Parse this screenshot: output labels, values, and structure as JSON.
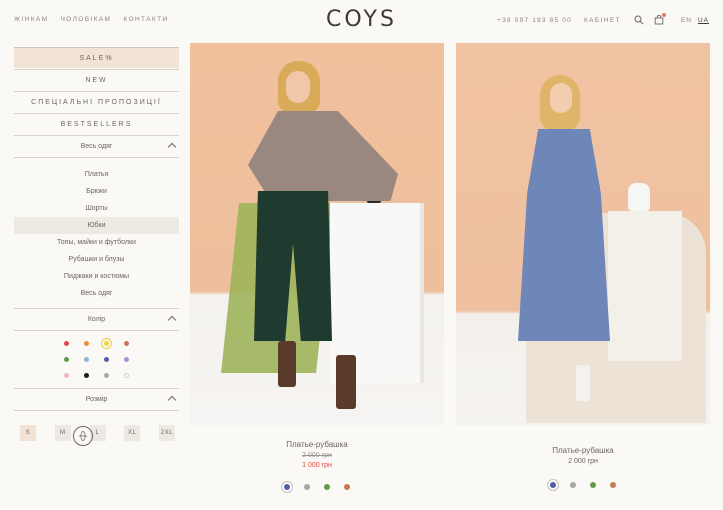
{
  "header": {
    "nav_women": "ЖІНКАМ",
    "nav_men": "ЧОЛОВІКАМ",
    "nav_contacts": "КОНТАКТИ",
    "logo": "COYS",
    "phone": "+38 097 193 85 00",
    "cabinet": "КАБІНЕТ",
    "icons": [
      "search-icon",
      "cart-icon"
    ],
    "lang_en": "EN",
    "lang_ua": "UA"
  },
  "sidebar": {
    "sale": "SALE%",
    "new": "NEW",
    "special": "СПЕЦІАЛЬНІ ПРОПОЗИЦІЇ",
    "bestsellers": "BESTSELLERS",
    "all_clothes_head": "Весь одяг",
    "categories": [
      "Платья",
      "Брюки",
      "Шорты",
      "Юбки",
      "Топы, майки и футболки",
      "Рубашки и блузы",
      "Пиджаки и костюмы",
      "Весь одяг"
    ],
    "active_category": "Юбки",
    "color_head": "Колір",
    "swatches": [
      "#e5484d",
      "#ef8f3a",
      "#f3d23a",
      "#c27a56",
      "#5f9a4a",
      "#8fb6d8",
      "#5060a8",
      "#a98fd4",
      "#f2b6c2",
      "#1b1b1b",
      "#a9a9a9",
      "#ffffff"
    ],
    "selected_swatch": "#f3d23a",
    "size_head": "Розмір",
    "sizes": [
      "S",
      "M",
      "L",
      "XL",
      "2XL"
    ],
    "selected_size": "S"
  },
  "products": [
    {
      "name": "Платье-рубашка",
      "old_price": "2 000 грн",
      "price": "1 000 грн",
      "colors": [
        "#4f5fb0",
        "#a7a7a7",
        "#5e9c4a",
        "#c47a52"
      ],
      "selected_color": "#4f5fb0"
    },
    {
      "name": "Платье-рубашка",
      "price": "2 000 грн",
      "colors": [
        "#4f5fb0",
        "#a7a7a7",
        "#5e9c4a",
        "#c47a52"
      ],
      "selected_color": "#4f5fb0"
    }
  ]
}
